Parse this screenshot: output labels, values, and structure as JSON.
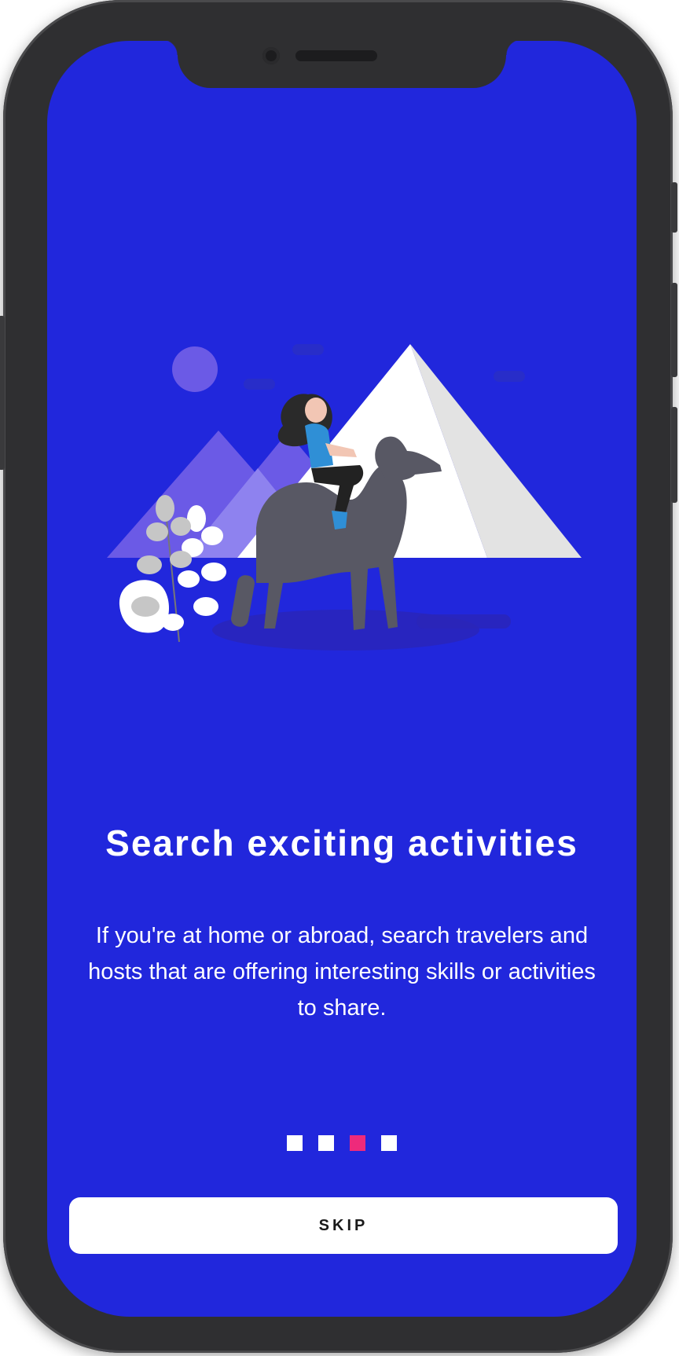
{
  "onboarding": {
    "title": "Search exciting activities",
    "description": "If you're at home or abroad, search travelers and hosts that are offering interesting skills or activities to share.",
    "pagination": {
      "total": 4,
      "active_index": 2
    },
    "skip_label": "SKIP"
  },
  "colors": {
    "background": "#2127dc",
    "active_dot": "#ee2a7b",
    "inactive_dot": "#ffffff",
    "button_bg": "#ffffff"
  },
  "illustration": {
    "semantic": "woman-riding-camel-pyramids-illustration"
  }
}
